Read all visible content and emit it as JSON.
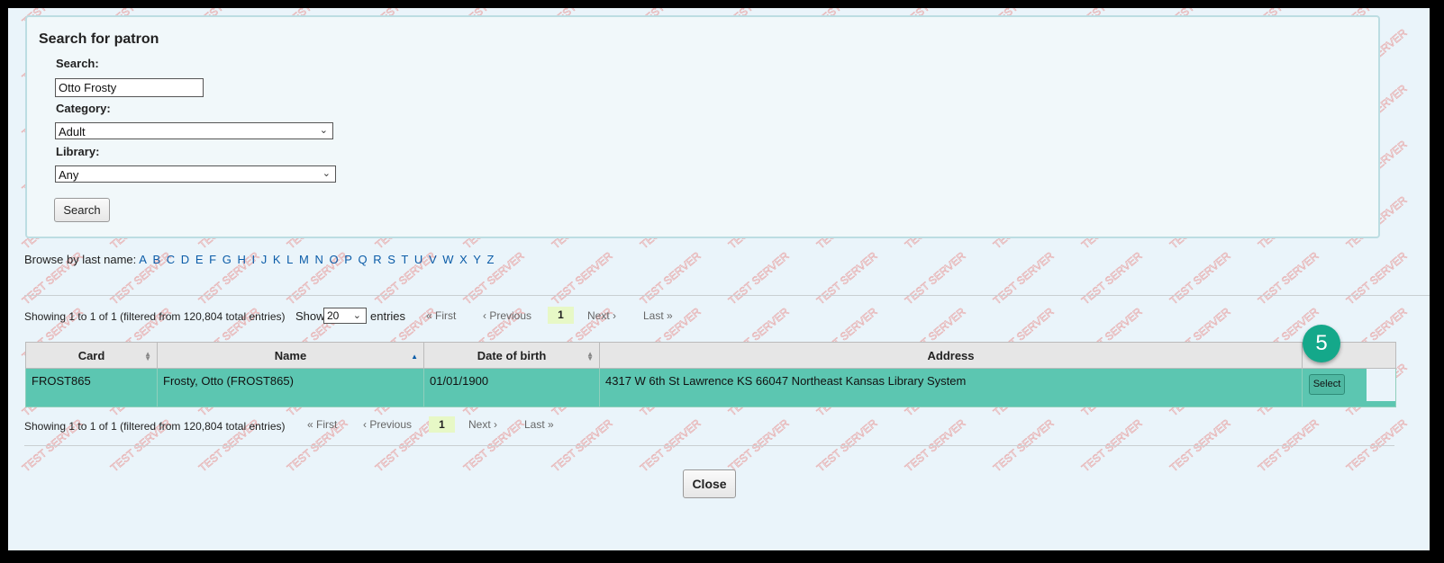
{
  "panel": {
    "title": "Search for patron",
    "search_label": "Search:",
    "search_value": "Otto Frosty",
    "category_label": "Category:",
    "category_value": "Adult",
    "library_label": "Library:",
    "library_value": "Any",
    "search_button": "Search"
  },
  "browse": {
    "label": "Browse by last name:",
    "letters": [
      "A",
      "B",
      "C",
      "D",
      "E",
      "F",
      "G",
      "H",
      "I",
      "J",
      "K",
      "L",
      "M",
      "N",
      "O",
      "P",
      "Q",
      "R",
      "S",
      "T",
      "U",
      "V",
      "W",
      "X",
      "Y",
      "Z"
    ]
  },
  "pagination_top": {
    "info": "Showing 1 to 1 of 1 (filtered from 120,804 total entries)",
    "show_label": "Show",
    "show_value": "20",
    "entries_label": "entries",
    "first": "« First",
    "previous": "‹ Previous",
    "current": "1",
    "next": "Next ›",
    "last": "Last »"
  },
  "table": {
    "headers": [
      "Card",
      "Name",
      "Date of birth",
      "Address"
    ],
    "rows": [
      {
        "card": "FROST865",
        "name": "Frosty, Otto (FROST865)",
        "dob": "01/01/1900",
        "address": "4317 W 6th St Lawrence KS 66047 Northeast Kansas Library System",
        "action": "Select"
      }
    ]
  },
  "pagination_bottom": {
    "info": "Showing 1 to 1 of 1 (filtered from 120,804 total entries)",
    "first": "« First",
    "previous": "‹ Previous",
    "current": "1",
    "next": "Next ›",
    "last": "Last »"
  },
  "close_button": "Close",
  "step_badge": "5",
  "watermark": "TEST SERVER",
  "colors": {
    "row_highlight": "#5cc6b1",
    "badge": "#14a88a",
    "link": "#0b5ca8",
    "current_page": "#e7f8c6",
    "watermark": "#e8a8a8"
  }
}
